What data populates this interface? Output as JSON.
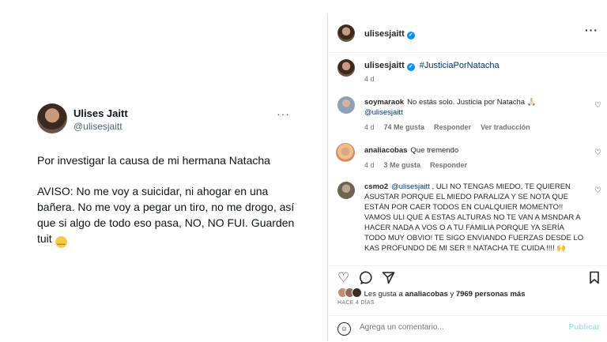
{
  "tweet": {
    "name": "Ulises Jaitt",
    "handle": "@ulisesjaitt",
    "more": "···",
    "paragraph1": "Por investigar la causa de mi hermana Natacha",
    "paragraph2": "AVISO: No me voy a suicidar, ni ahogar en una bañera. No me voy a pegar un tiro, no me drogo, así que si algo de todo eso pasa, NO, NO FUI. Guarden tuit",
    "emoji": "pensive-face-emoji"
  },
  "instagram": {
    "header_user": "ulisesjaitt",
    "caption": {
      "user": "ulisesjaitt",
      "hashtag": "#JusticiaPorNatacha",
      "time": "4 d"
    },
    "comments": [
      {
        "user": "soymaraok",
        "text": "No estás solo. Justicia por Natacha 🙏🏻",
        "mention": "@ulisesjaitt",
        "time": "4 d",
        "likes": "74 Me gusta",
        "reply": "Responder",
        "translate": "Ver traducción"
      },
      {
        "user": "analiacobas",
        "text": "Que tremendo",
        "time": "4 d",
        "likes": "3 Me gusta",
        "reply": "Responder"
      },
      {
        "user": "csmo2",
        "mention": "@ulisesjaitt",
        "text": ", ULI NO TENGAS MIEDO, TE QUIEREN ASUSTAR PORQUE EL MIEDO PARALIZA Y SE NOTA QUE ESTÁN POR CAER TODOS EN CUALQUIER MOMENTO!! VAMOS ULI QUE A ESTAS ALTURAS NO TE VAN A MSNDAR A HACER NADA A VOS O A TU FAMILIA PORQUE YA SERÍA TODO MUY OBVIO! TE SIGO ENVIANDO FUERZAS DESDE LO KAS PROFUNDO DE MI SER !! NATACHA TE CUIDA !!!! 🙌"
      }
    ],
    "likes_prefix": "Les gusta a",
    "likes_user": "analiacobas",
    "likes_and": "y",
    "likes_count": "7969 personas más",
    "ago": "HACE 4 DÍAS",
    "comment_placeholder": "Agrega un comentario...",
    "publish_label": "Publicar",
    "colors": {
      "accent": "#0095f6",
      "link": "#00376b",
      "muted": "#737373"
    },
    "icons": [
      "heart-icon",
      "comment-icon",
      "share-icon",
      "bookmark-icon",
      "smiley-icon",
      "more-icon",
      "verified-badge-icon"
    ]
  }
}
